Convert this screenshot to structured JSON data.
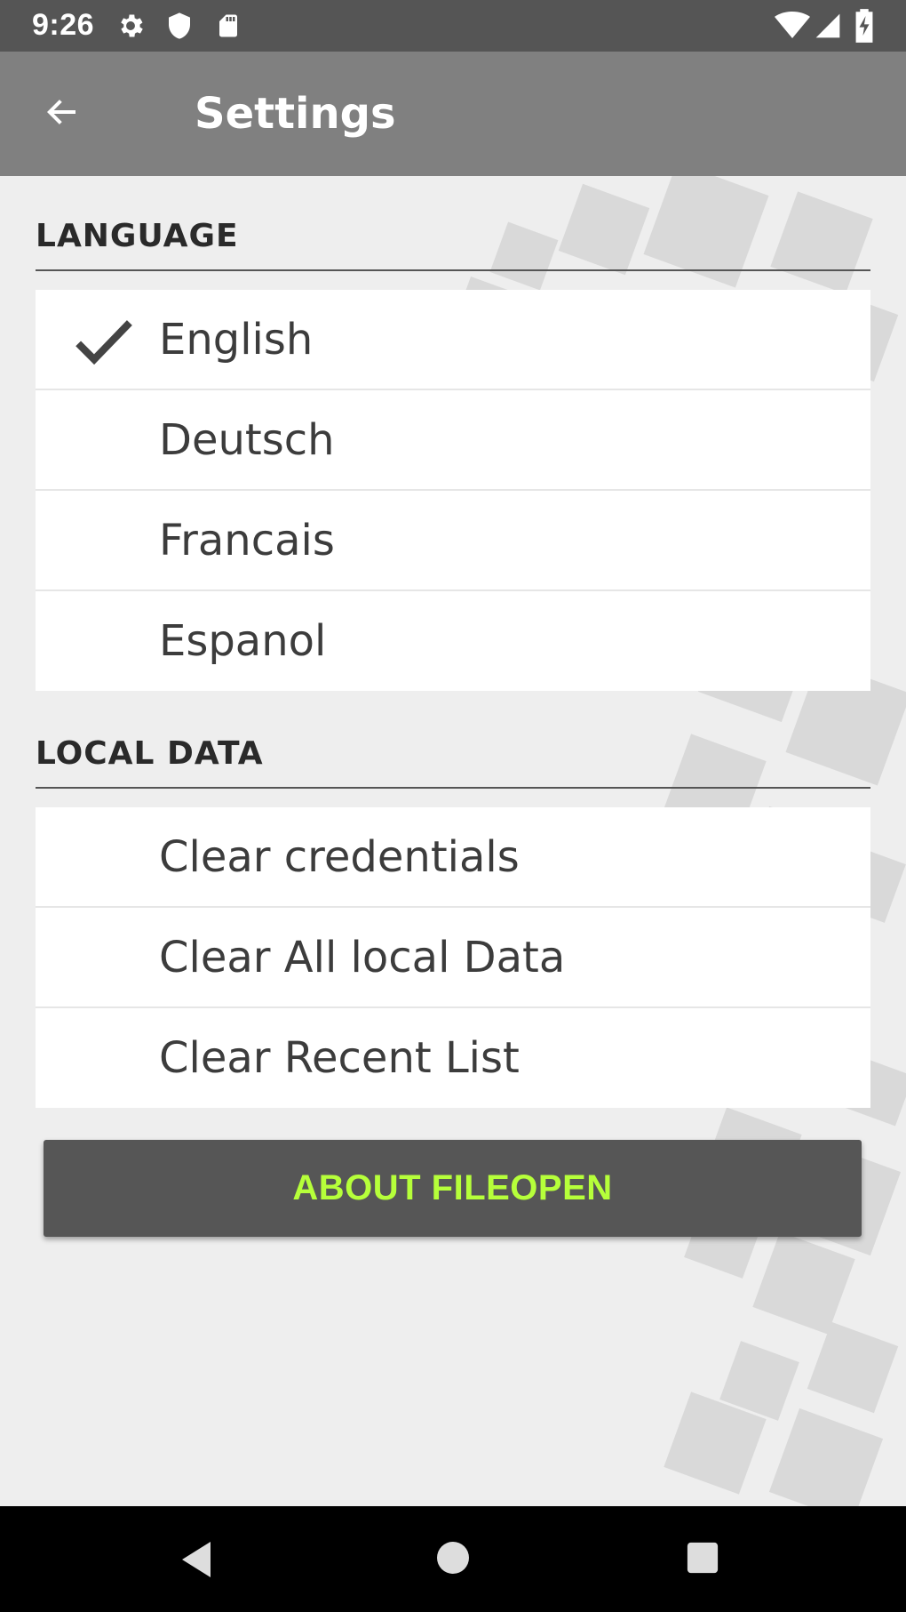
{
  "status_bar": {
    "time": "9:26",
    "left_icons": [
      "gear-icon",
      "shield-icon",
      "sd-card-icon"
    ],
    "right_icons": [
      "wifi-icon",
      "signal-icon",
      "battery-charging-icon"
    ]
  },
  "app_bar": {
    "title": "Settings",
    "back_icon": "arrow-left-icon"
  },
  "sections": {
    "language": {
      "header": "LANGUAGE",
      "items": [
        {
          "label": "English",
          "selected": true
        },
        {
          "label": "Deutsch",
          "selected": false
        },
        {
          "label": "Francais",
          "selected": false
        },
        {
          "label": "Espanol",
          "selected": false
        }
      ]
    },
    "local_data": {
      "header": "LOCAL DATA",
      "items": [
        {
          "label": "Clear credentials"
        },
        {
          "label": "Clear All local Data"
        },
        {
          "label": "Clear Recent List"
        }
      ]
    }
  },
  "about_button": {
    "label": "ABOUT FILEOPEN"
  },
  "nav_bar": {
    "buttons": [
      "back-triangle-icon",
      "home-circle-icon",
      "recents-square-icon"
    ]
  },
  "colors": {
    "status_bar": "#555555",
    "app_bar": "#808080",
    "background": "#eeeeee",
    "button_bg": "#565656",
    "button_text": "#b6ff3a",
    "nav_bar": "#000000"
  }
}
